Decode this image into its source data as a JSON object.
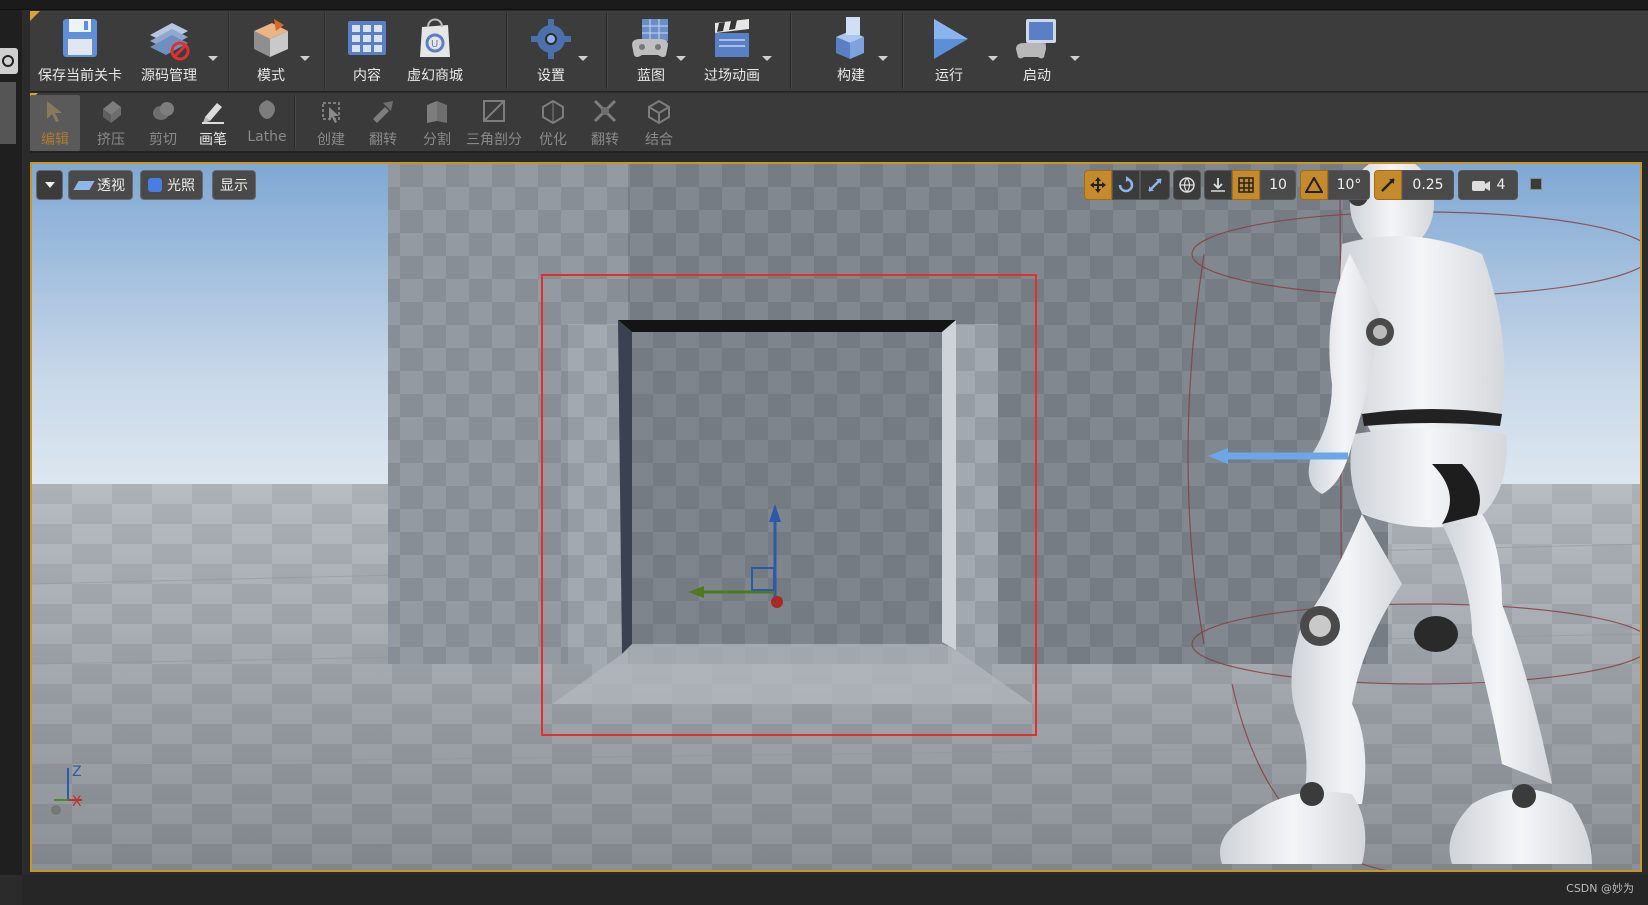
{
  "toolbar": {
    "items": [
      {
        "label": "保存当前关卡",
        "icon": "save-icon"
      },
      {
        "label": "源码管理",
        "icon": "source-control-icon"
      },
      {
        "label": "模式",
        "icon": "modes-icon"
      },
      {
        "label": "内容",
        "icon": "content-icon"
      },
      {
        "label": "虚幻商城",
        "icon": "marketplace-icon"
      },
      {
        "label": "设置",
        "icon": "settings-icon"
      },
      {
        "label": "蓝图",
        "icon": "blueprint-icon"
      },
      {
        "label": "过场动画",
        "icon": "cinematics-icon"
      },
      {
        "label": "构建",
        "icon": "build-icon"
      },
      {
        "label": "运行",
        "icon": "play-icon"
      },
      {
        "label": "启动",
        "icon": "launch-icon"
      }
    ]
  },
  "geometry_toolbar": {
    "items": [
      {
        "label": "编辑",
        "state": "selected"
      },
      {
        "label": "挤压",
        "state": "disabled"
      },
      {
        "label": "剪切",
        "state": "disabled"
      },
      {
        "label": "画笔",
        "state": "active"
      },
      {
        "label": "Lathe",
        "state": "disabled"
      },
      {
        "label": "创建",
        "state": "disabled"
      },
      {
        "label": "翻转",
        "state": "disabled"
      },
      {
        "label": "分割",
        "state": "disabled"
      },
      {
        "label": "三角剖分",
        "state": "disabled"
      },
      {
        "label": "优化",
        "state": "disabled"
      },
      {
        "label": "翻转",
        "state": "disabled"
      },
      {
        "label": "结合",
        "state": "disabled"
      }
    ]
  },
  "viewport": {
    "perspective_label": "透视",
    "lighting_label": "光照",
    "show_label": "显示",
    "grid_snap_value": "10",
    "rotation_snap_value": "10°",
    "scale_snap_value": "0.25",
    "camera_speed_value": "4",
    "axis_labels": {
      "z": "Z",
      "x": "X"
    },
    "colors": {
      "selection_border": "#e0302c",
      "viewport_border": "#c9962c",
      "accent_orange": "#c58a2b"
    }
  },
  "watermark": "CSDN @妙为"
}
